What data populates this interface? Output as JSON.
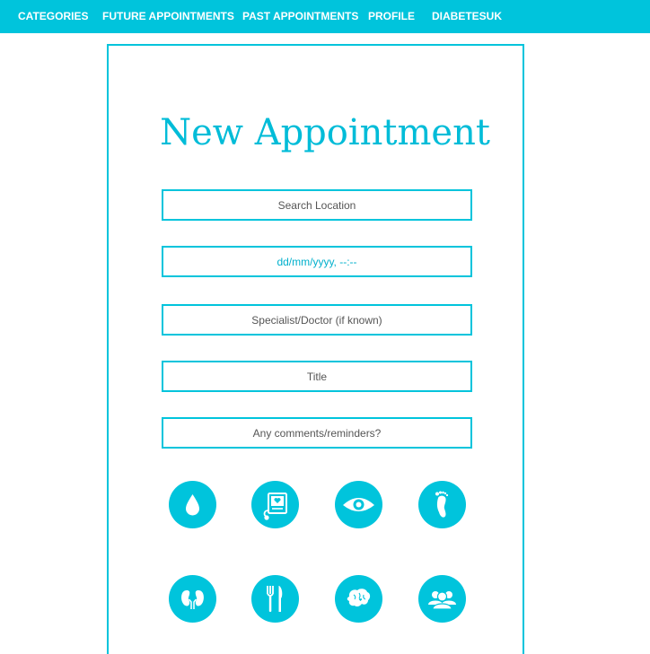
{
  "nav": {
    "items": [
      {
        "label": "CATEGORIES"
      },
      {
        "label": "FUTURE APPOINTMENTS"
      },
      {
        "label": "PAST APPOINTMENTS"
      },
      {
        "label": "PROFILE"
      },
      {
        "label": "DIABETESUK"
      }
    ]
  },
  "page": {
    "title": "New Appointment"
  },
  "form": {
    "location_placeholder": "Search Location",
    "datetime_placeholder": "dd/mm/yyyy, --:--",
    "doctor_placeholder": "Specialist/Doctor (if known)",
    "title_placeholder": "Title",
    "comments_placeholder": "Any comments/reminders?"
  },
  "categories": [
    {
      "icon": "blood-drop-icon"
    },
    {
      "icon": "blood-pressure-monitor-icon"
    },
    {
      "icon": "eye-icon"
    },
    {
      "icon": "foot-icon"
    },
    {
      "icon": "kidneys-icon"
    },
    {
      "icon": "fork-knife-icon"
    },
    {
      "icon": "brain-icon"
    },
    {
      "icon": "group-people-icon"
    }
  ],
  "colors": {
    "accent": "#00c4dc",
    "title": "#00bcd8",
    "text": "#555555"
  }
}
